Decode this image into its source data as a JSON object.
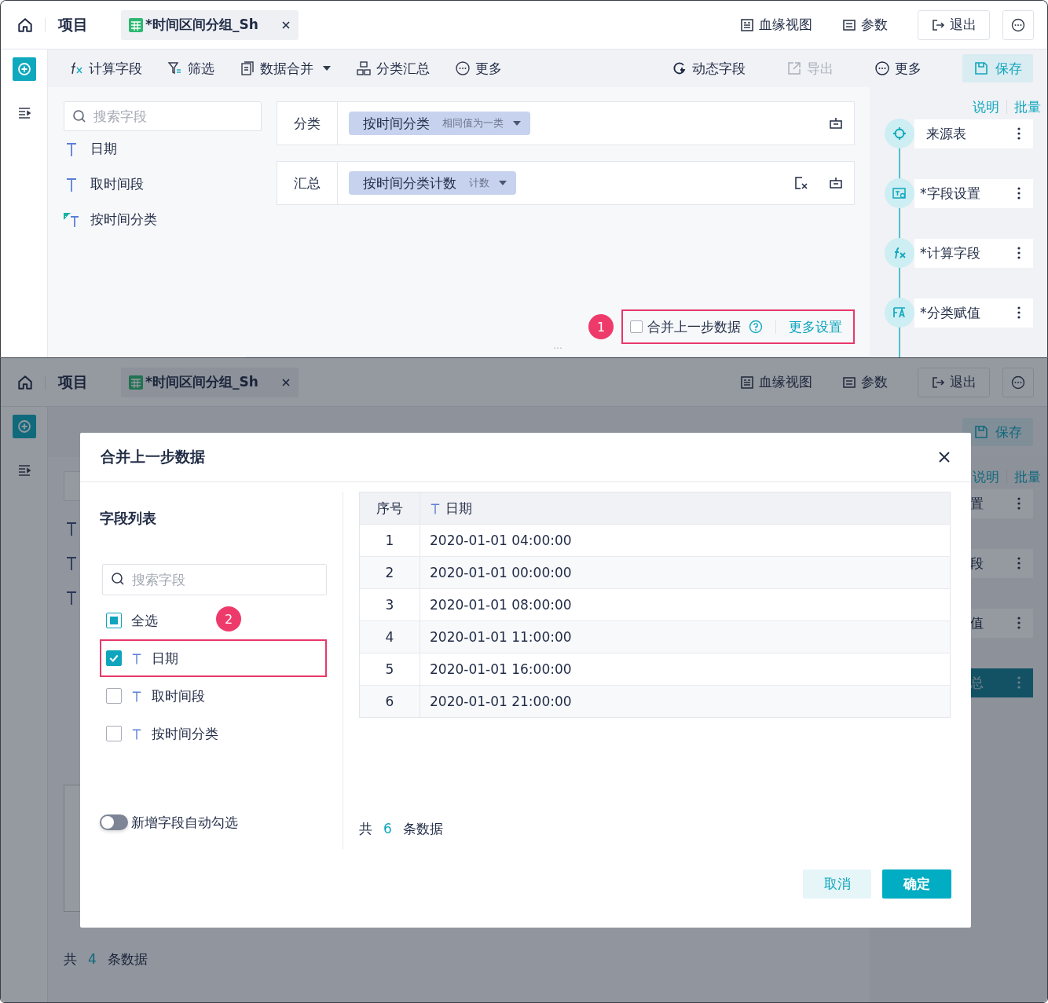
{
  "top": {
    "header": {
      "project": "项目",
      "tab": "*时间区间分组_Sh",
      "actions": [
        {
          "label": "血缘视图",
          "kind": "lineage"
        },
        {
          "label": "参数",
          "kind": "params"
        }
      ],
      "exit": "退出"
    },
    "toolbar_left": [
      {
        "label": "计算字段",
        "kind": "fx",
        "dropdown": false
      },
      {
        "label": "筛选",
        "kind": "filter",
        "dropdown": false
      },
      {
        "label": "数据合并",
        "kind": "merge",
        "dropdown": true
      },
      {
        "label": "分类汇总",
        "kind": "group",
        "dropdown": false
      },
      {
        "label": "更多",
        "kind": "more",
        "dropdown": false
      }
    ],
    "toolbar_right": [
      {
        "label": "动态字段",
        "kind": "dynamic",
        "disabled": false
      },
      {
        "label": "导出",
        "kind": "export",
        "disabled": true
      },
      {
        "label": "更多",
        "kind": "more",
        "disabled": false
      }
    ],
    "save": "保存",
    "search": {
      "placeholder": "搜索字段"
    },
    "fields": [
      {
        "name": "日期",
        "kind": "text"
      },
      {
        "name": "取时间段",
        "kind": "text"
      },
      {
        "name": "按时间分类",
        "kind": "new"
      }
    ],
    "groups": [
      {
        "label": "分类",
        "chip": "按时间分类",
        "sub": "相同值为一类",
        "clearable": false
      },
      {
        "label": "汇总",
        "chip": "按时间分类计数",
        "sub": "计数",
        "clearable": true
      }
    ],
    "resize_handle": "···",
    "merge": {
      "badge": "1",
      "checked": false,
      "label": "合并上一步数据",
      "link": "更多设置",
      "highlighted": true
    },
    "side_links": [
      "说明",
      "批量"
    ],
    "steps": [
      {
        "name": "来源表",
        "kind": "source"
      },
      {
        "name": "*字段设置",
        "kind": "fields"
      },
      {
        "name": "*计算字段",
        "kind": "fx"
      },
      {
        "name": "*分类赋值",
        "kind": "assign"
      }
    ]
  },
  "bottom": {
    "header": {
      "project": "项目",
      "tab": "*时间区间分组_Sh",
      "actions": [
        {
          "label": "血缘视图",
          "kind": "lineage"
        },
        {
          "label": "参数",
          "kind": "params"
        }
      ],
      "exit": "退出"
    },
    "save": "保存",
    "side_links": [
      "说明",
      "批量"
    ],
    "steps": [
      {
        "name": "置",
        "selected": false
      },
      {
        "name": "段",
        "selected": false
      },
      {
        "name": "值",
        "selected": false
      },
      {
        "name": "总",
        "selected": true
      }
    ],
    "footer": {
      "prefix": "共",
      "count": "4",
      "suffix": "条数据"
    },
    "dialog": {
      "title": "合并上一步数据",
      "list_title": "字段列表",
      "search": {
        "placeholder": "搜索字段"
      },
      "select_all": {
        "label": "全选",
        "indeterminate": true,
        "badge": "2"
      },
      "fields": [
        {
          "name": "日期",
          "checked": true,
          "highlighted": true
        },
        {
          "name": "取时间段",
          "checked": false,
          "highlighted": false
        },
        {
          "name": "按时间分类",
          "checked": false,
          "highlighted": false
        }
      ],
      "toggle": {
        "label": "新增字段自动勾选",
        "on": false
      },
      "columns": [
        "序号",
        "日期"
      ],
      "rows": [
        [
          "1",
          "2020-01-01 04:00:00"
        ],
        [
          "2",
          "2020-01-01 00:00:00"
        ],
        [
          "3",
          "2020-01-01 08:00:00"
        ],
        [
          "4",
          "2020-01-01 11:00:00"
        ],
        [
          "5",
          "2020-01-01 16:00:00"
        ],
        [
          "6",
          "2020-01-01 21:00:00"
        ]
      ],
      "count": {
        "prefix": "共",
        "count": "6",
        "suffix": "条数据"
      },
      "cancel": "取消",
      "ok": "确定"
    }
  }
}
